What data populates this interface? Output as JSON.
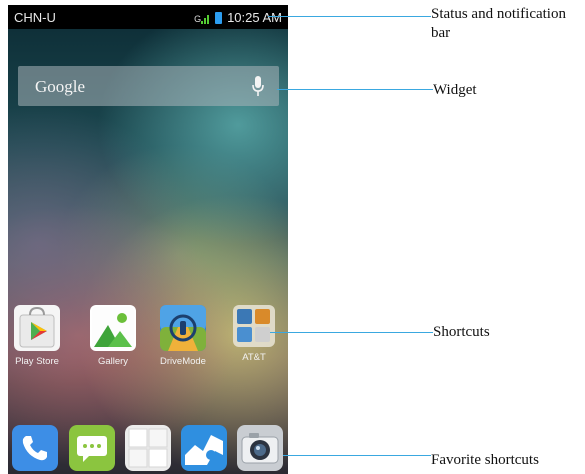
{
  "status_bar": {
    "carrier": "CHN-U",
    "network_indicator": "G",
    "time": "10:25 AM"
  },
  "widget": {
    "search_label": "Google",
    "mic_icon": "microphone-icon"
  },
  "shortcuts": [
    {
      "label": "Play Store",
      "icon": "play-store-icon"
    },
    {
      "label": "Gallery",
      "icon": "gallery-icon"
    },
    {
      "label": "DriveMode",
      "icon": "drivemode-icon"
    },
    {
      "label": "AT&T",
      "icon": "att-folder-icon"
    }
  ],
  "favorites": [
    {
      "icon": "phone-icon"
    },
    {
      "icon": "messaging-icon"
    },
    {
      "icon": "apps-drawer-icon"
    },
    {
      "icon": "maps-icon"
    },
    {
      "icon": "camera-icon"
    }
  ],
  "callouts": {
    "status": "Status and notification bar",
    "widget": "Widget",
    "shortcuts": "Shortcuts",
    "favorites": "Favorite shortcuts"
  },
  "colors": {
    "callout_line": "#3aa8e0",
    "signal_green": "#55cc33",
    "battery_blue": "#2c9df0"
  }
}
